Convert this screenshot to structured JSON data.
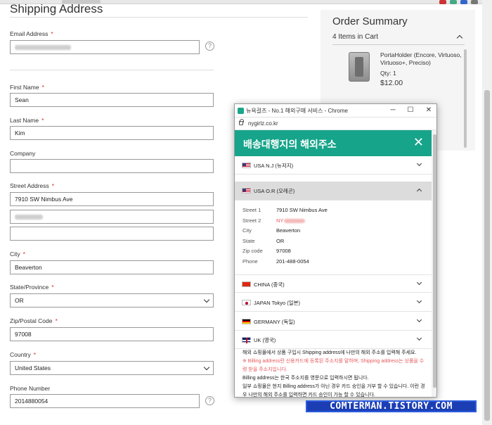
{
  "checkout": {
    "section_title": "Shipping Address",
    "required_mark": "*",
    "help_symbol": "?",
    "fields": {
      "email": {
        "label": "Email Address",
        "value": ""
      },
      "first_name": {
        "label": "First Name",
        "value": "Sean"
      },
      "last_name": {
        "label": "Last Name",
        "value": "Kim"
      },
      "company": {
        "label": "Company",
        "value": ""
      },
      "street": {
        "label": "Street Address",
        "line1": "7910 SW Nimbus Ave",
        "line2": "",
        "line3": ""
      },
      "city": {
        "label": "City",
        "value": "Beaverton"
      },
      "state": {
        "label": "State/Province",
        "value": "OR"
      },
      "zip": {
        "label": "Zip/Postal Code",
        "value": "97008"
      },
      "country": {
        "label": "Country",
        "value": "United States"
      },
      "phone": {
        "label": "Phone Number",
        "value": "2014880054"
      }
    }
  },
  "order_summary": {
    "title": "Order Summary",
    "items_in_cart": "4 Items in Cart",
    "item": {
      "name": "PortaHolder (Encore, Virtuoso, Virtuoso+, Preciso)",
      "qty": "Qty: 1",
      "price": "$12.00"
    }
  },
  "popup": {
    "window_title": "뉴욕걸즈 - No.1 해외구매 서비스 - Chrome",
    "url": "nygirlz.co.kr",
    "controls": {
      "minimize": "─",
      "maximize": "☐",
      "close": "✕"
    },
    "banner_title": "배송대행지의 해외주소",
    "banner_close": "✕",
    "regions": [
      {
        "label": "USA N.J (뉴저지)",
        "flag": "us-flag-icon"
      },
      {
        "label": "USA O.R (오레곤)",
        "flag": "us-flag-icon",
        "expanded": true
      },
      {
        "label": "CHINA (중국)",
        "flag": "china-flag-icon"
      },
      {
        "label": "JAPAN Tokyo (일본)",
        "flag": "japan-flag-icon"
      },
      {
        "label": "GERMANY (독일)",
        "flag": "germany-flag-icon"
      },
      {
        "label": "UK (영국)",
        "flag": "uk-flag-icon"
      }
    ],
    "address": {
      "street1_key": "Street 1",
      "street1": "7910 SW Nimbus Ave",
      "street2_key": "Street 2",
      "street2": "NY",
      "city_key": "City",
      "city": "Beaverton",
      "state_key": "State",
      "state": "OR",
      "zip_key": "Zip code",
      "zip": "97008",
      "phone_key": "Phone",
      "phone": "201-488-0054"
    },
    "notes": {
      "line1": "해외 쇼핑몰에서 상품 구입시 Shipping address에 나만의 해외 주소를 입력해 주세요.",
      "line2_red": "※ Billing address란 신용카드에 등록된 주소지를 말하며, Shipping address는 상품을 수령 받을 주소지입니다.",
      "line3": "Billing address는 한국 주소지를 영문으로 입력하시면 됩니다.",
      "line4": "일부 쇼핑몰은 현지 Billing address가 아닌 경우 카드 승인을 거부 할 수 있습니다. 이런 경우 나만의 해외 주소를 입력하면 카드 승인이 가능 할 수 있습니다."
    }
  },
  "watermark": "COMTERMAN.TISTORY.COM",
  "colors": {
    "banner": "#16a48a",
    "required": "#e02b27",
    "note_red": "#e8595b",
    "watermark": "#1c3eb4"
  }
}
